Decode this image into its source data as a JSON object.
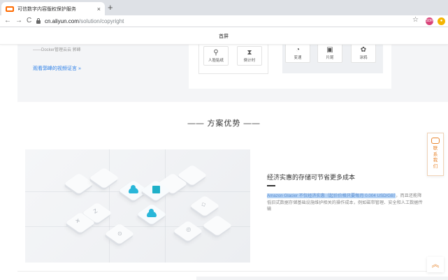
{
  "browser": {
    "tab_title": "可信数字内容版权保护服务",
    "tab_close": "×",
    "new_tab": "+",
    "back": "←",
    "forward": "→",
    "reload": "C",
    "url_host": "cn.aliyun.com",
    "url_path": "/solution/copyright",
    "bookmark": "☆",
    "profile": "SDR",
    "extension": "●"
  },
  "subnav": {
    "title": "首屏"
  },
  "top_section": {
    "quote": "——Docker管理云云 郭峰",
    "video_link": "观看郭峰的视频证言 »",
    "features_left": [
      {
        "icon": "person-icon",
        "glyph": "⚲",
        "label": "人脸贴纸"
      },
      {
        "icon": "hourglass-icon",
        "glyph": "⧗",
        "label": "倒计时"
      }
    ],
    "features_right": [
      {
        "icon": "speedometer-icon",
        "glyph": "◔",
        "label": "变速"
      },
      {
        "icon": "film-icon",
        "glyph": "▣",
        "label": "片尾"
      },
      {
        "icon": "palette-icon",
        "glyph": "✿",
        "label": "涂鸦"
      }
    ]
  },
  "advantages": {
    "section_title": "—— 方案优势 ——",
    "benefit_title": "经济实惠的存储可节省更多成本",
    "benefit_highlight": "Amazon Glacier 不仅经济实惠（起价价格只要每月 0.004 USD/GB）",
    "benefit_rest": "，而且还能降低旧式数据存储基础设施维护相关的操作成本，例如磁带管理、安全和人工数据传输",
    "illustration_labels": [
      "Z",
      "⊙",
      "✕",
      "◎",
      "◇"
    ]
  },
  "widgets": {
    "contact_label": "联系我们",
    "back_to_top": "︽"
  },
  "colors": {
    "accent": "#e8862e",
    "link": "#2b7fe8",
    "highlight": "#b7d4f5",
    "cloud": "#28b6d9"
  }
}
